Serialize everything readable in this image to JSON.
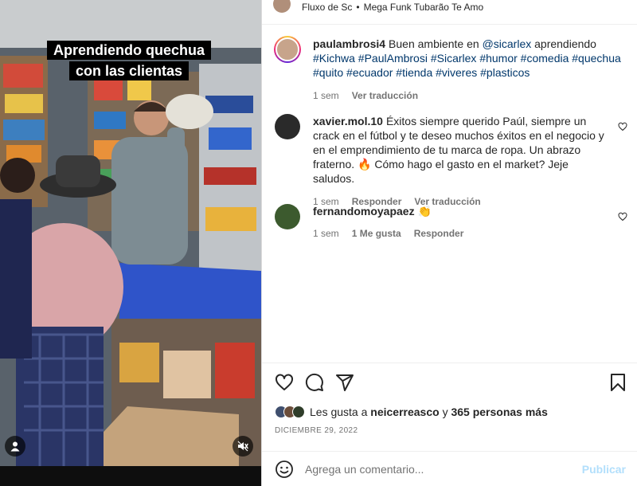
{
  "video": {
    "caption_line1": "Aprendiendo quechua",
    "caption_line2": "con las clientas"
  },
  "audio": {
    "account": "Fluxo de Sc",
    "separator": "•",
    "track": "Mega Funk Tubarão Te Amo"
  },
  "caption_post": {
    "username": "paulambrosi4",
    "text_before": "Buen ambiente en ",
    "mention": "@sicarlex",
    "text_after": " aprendiendo",
    "hashtags": "#Kichwa #PaulAmbrosi #Sicarlex #humor #comedia #quechua #quito #ecuador #tienda #viveres #plasticos",
    "time": "1 sem",
    "translate": "Ver traducción"
  },
  "comments": [
    {
      "username": "xavier.mol.10",
      "text": "Éxitos siempre querido Paúl, siempre un crack en el fútbol y te deseo muchos éxitos en el negocio y en el emprendimiento de tu marca de ropa. Un abrazo fraterno. 🔥 Cómo hago el gasto en el market? Jeje saludos.",
      "time": "1 sem",
      "reply": "Responder",
      "translate": "Ver traducción"
    },
    {
      "username": "fernandomoyapaez",
      "text": "👏",
      "time": "1 sem",
      "likes": "1 Me gusta",
      "reply": "Responder"
    }
  ],
  "likes": {
    "prefix": "Les gusta a ",
    "user": "neicerreasco",
    "middle": " y ",
    "others": "365 personas más"
  },
  "date": "DICIEMBRE 29, 2022",
  "add_comment": {
    "placeholder": "Agrega un comentario...",
    "publish": "Publicar"
  },
  "colors": {
    "link": "#00376b",
    "muted": "#737373",
    "publish_disabled": "#b2dffc"
  }
}
